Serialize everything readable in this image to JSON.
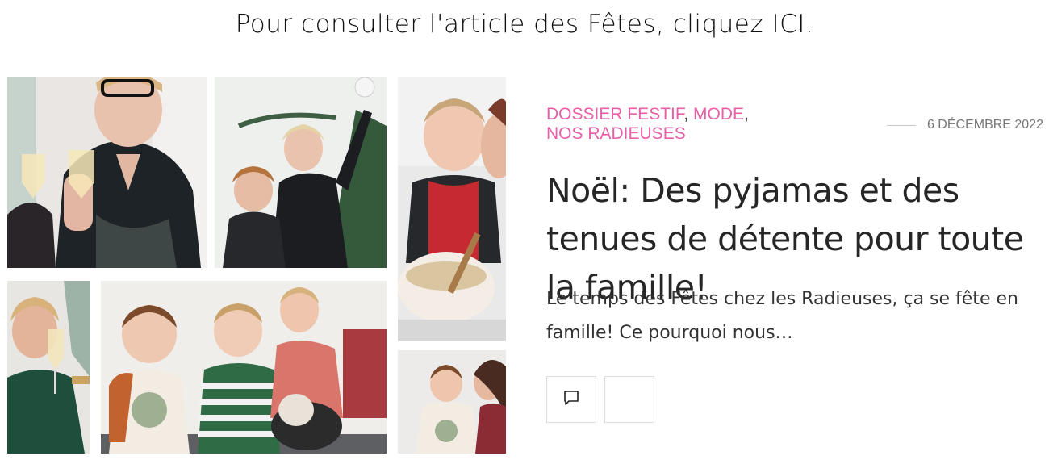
{
  "banner": {
    "text": "Pour consulter l'article des Fêtes, cliquez ICI."
  },
  "article": {
    "categories": [
      {
        "label": "DOSSIER FESTIF",
        "sep": ","
      },
      {
        "label": "MODE",
        "sep": ","
      },
      {
        "label": "NOS RADIEUSES",
        "sep": ""
      }
    ],
    "date": "6 DÉCEMBRE 2022",
    "title": "Noël: Des pyjamas et des tenues de détente pour toute la famille!",
    "excerpt": "Le temps des Fêtes chez les Radieuses, ça se fête en famille! Ce pourquoi nous…",
    "actions": {
      "comment_icon": "comment-icon",
      "second_button_icon": ""
    }
  },
  "colors": {
    "category": "#e85fa8",
    "date": "#777777",
    "title": "#262626"
  }
}
